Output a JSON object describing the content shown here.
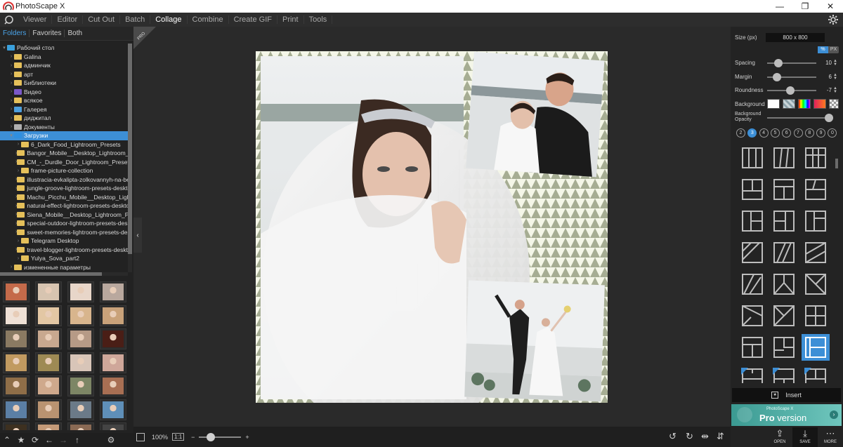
{
  "window": {
    "title": "PhotoScape X",
    "minimize": "—",
    "maximize": "❐",
    "close": "✕"
  },
  "menu": {
    "tabs": [
      "Viewer",
      "Editor",
      "Cut Out",
      "Batch",
      "Collage",
      "Combine",
      "Create GIF",
      "Print",
      "Tools"
    ],
    "active": "Collage"
  },
  "left": {
    "tabs": [
      "Folders",
      "Favorites",
      "Both"
    ],
    "tree": [
      {
        "label": "Рабочий стол",
        "type": "desk",
        "indent": 0,
        "arrow": "▾"
      },
      {
        "label": "Galina",
        "type": "folder",
        "indent": 1,
        "arrow": "›"
      },
      {
        "label": "админчик",
        "type": "folder",
        "indent": 1,
        "arrow": "›"
      },
      {
        "label": "арт",
        "type": "folder",
        "indent": 1,
        "arrow": "›"
      },
      {
        "label": "Библиотеки",
        "type": "folder",
        "indent": 1,
        "arrow": "›"
      },
      {
        "label": "Видео",
        "type": "vid",
        "indent": 1,
        "arrow": "›"
      },
      {
        "label": "всякое",
        "type": "folder",
        "indent": 1,
        "arrow": "›"
      },
      {
        "label": "Галерея",
        "type": "pic",
        "indent": 1,
        "arrow": "›"
      },
      {
        "label": "диджитал",
        "type": "folder",
        "indent": 1,
        "arrow": "›"
      },
      {
        "label": "Документы",
        "type": "doc",
        "indent": 1,
        "arrow": "›"
      },
      {
        "label": "Загрузки",
        "type": "dl",
        "indent": 1,
        "arrow": "▾",
        "selected": true
      },
      {
        "label": "6_Dark_Food_Lightroom_Presets",
        "type": "folder",
        "indent": 2,
        "arrow": "›"
      },
      {
        "label": "Bangor_Mobile__Desktop_Lightroom_Pr",
        "type": "folder",
        "indent": 2,
        "arrow": "›"
      },
      {
        "label": "CM_-_Durdle_Door_Lightroom_Presets_",
        "type": "folder",
        "indent": 2,
        "arrow": "›"
      },
      {
        "label": "frame-picture-collection",
        "type": "folder",
        "indent": 2,
        "arrow": "›"
      },
      {
        "label": "illustracia-evkalipta-zolkovannyh-na-beloi",
        "type": "folder",
        "indent": 2,
        "arrow": "›"
      },
      {
        "label": "jungle-groove-lightroom-presets-desktop",
        "type": "folder",
        "indent": 2,
        "arrow": "›"
      },
      {
        "label": "Machu_Picchu_Mobile__Desktop_Lightro",
        "type": "folder",
        "indent": 2,
        "arrow": "›"
      },
      {
        "label": "natural-effect-lightroom-presets-desktop",
        "type": "folder",
        "indent": 2,
        "arrow": "›"
      },
      {
        "label": "Siena_Mobile__Desktop_Lightroom_Pre",
        "type": "folder",
        "indent": 2,
        "arrow": "›"
      },
      {
        "label": "special-outdoor-lightroom-presets-deskt",
        "type": "folder",
        "indent": 2,
        "arrow": "›"
      },
      {
        "label": "sweet-memories-lightroom-presets-deskt",
        "type": "folder",
        "indent": 2,
        "arrow": "›"
      },
      {
        "label": "Telegram Desktop",
        "type": "folder",
        "indent": 2,
        "arrow": "›"
      },
      {
        "label": "travel-blogger-lightroom-presets-desktop",
        "type": "folder",
        "indent": 2,
        "arrow": "›"
      },
      {
        "label": "Yulya_Sova_part2",
        "type": "folder",
        "indent": 2,
        "arrow": "›"
      },
      {
        "label": "измененные параметры",
        "type": "folder",
        "indent": 1,
        "arrow": "›"
      }
    ],
    "thumbColors": [
      [
        "#c46a4a",
        "#d7c4b0",
        "#e8d6c9",
        "#b9a89e"
      ],
      [
        "#efe1d6",
        "#e3c7a4",
        "#d8b58d",
        "#c9a27a"
      ],
      [
        "#8a7a62",
        "#c8a88f",
        "#b69a86",
        "#4a1e16"
      ],
      [
        "#c19a60",
        "#9e8a54",
        "#d8c5b8",
        "#cfa79a"
      ],
      [
        "#8f6e48",
        "#cfa98c",
        "#7d8665",
        "#a86f53"
      ],
      [
        "#5b7fa5",
        "#b99371",
        "#6b7a88",
        "#5f8fb8"
      ],
      [
        "#3d3020",
        "#c49a78",
        "#8a6a54",
        "#444"
      ]
    ],
    "toolbar": [
      "★",
      "⟳",
      "←",
      "→",
      "↑",
      "⚙"
    ]
  },
  "canvas": {
    "pro_badge": "PRO",
    "zoom": "100%",
    "fit": "1:1",
    "zoom_level": 0.22,
    "minus": "−",
    "plus": "+"
  },
  "right": {
    "size_label": "Size (px)",
    "size_value": "800 x 800",
    "unit_percent": "%",
    "unit_px": "PX",
    "spacing_label": "Spacing",
    "spacing_value": "10",
    "spacing_level": 0.18,
    "margin_label": "Margin",
    "margin_value": "6",
    "margin_level": 0.14,
    "roundness_label": "Roundness",
    "roundness_value": "-7",
    "roundness_level": 0.47,
    "background_label": "Background",
    "opacity_label": "Background Opacity",
    "opacity_level": 1.0,
    "counts": [
      "2",
      "3",
      "4",
      "5",
      "6",
      "7",
      "8",
      "9",
      "0"
    ],
    "count_selected": "3",
    "insert_label": "Insert",
    "pro_small": "PhotoScape X",
    "pro_big_a": "Pro",
    "pro_big_b": " version",
    "buttons": [
      {
        "icon": "⇪",
        "label": "OPEN"
      },
      {
        "icon": "⤓",
        "label": "SAVE"
      },
      {
        "icon": "⋯",
        "label": "MORE"
      }
    ]
  },
  "colors": {
    "accent": "#3d8fd6",
    "frame": "#f4f6e8",
    "frame_pattern": "#9aa28a"
  }
}
